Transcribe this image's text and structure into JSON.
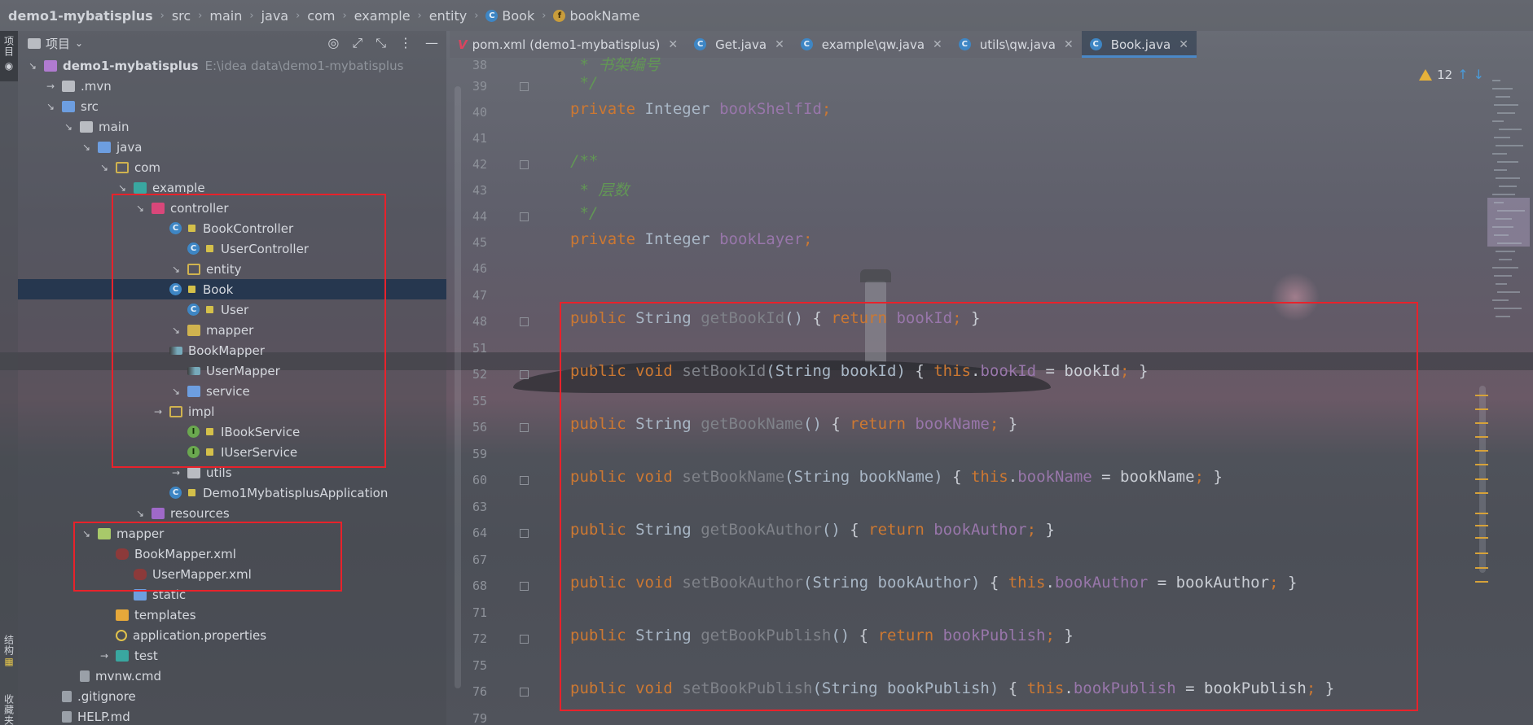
{
  "breadcrumb": [
    {
      "label": "demo1-mybatisplus",
      "bold": true
    },
    {
      "label": "src"
    },
    {
      "label": "main"
    },
    {
      "label": "java"
    },
    {
      "label": "com"
    },
    {
      "label": "example"
    },
    {
      "label": "entity"
    },
    {
      "label": "Book",
      "icon": "class-c-icon"
    },
    {
      "label": "bookName",
      "icon": "field-f-icon"
    }
  ],
  "left_strip": {
    "project_tab": "项目",
    "structure_tab": "结构",
    "favorites_tab": "收藏夹"
  },
  "project_panel": {
    "title": "项目",
    "tree": [
      {
        "label": "demo1-mybatisplus",
        "hint": "E:\\idea data\\demo1-mybatisplus",
        "bold": true,
        "icon": "module-icon",
        "arrow": "open"
      },
      {
        "label": ".mvn",
        "icon": "folder-icon",
        "arrow": "closed"
      },
      {
        "label": "src",
        "icon": "src-folder-icon",
        "arrow": "open"
      },
      {
        "label": "main",
        "icon": "folder-icon",
        "arrow": "open"
      },
      {
        "label": "java",
        "icon": "java-folder-icon",
        "arrow": "open"
      },
      {
        "label": "com",
        "icon": "package-icon",
        "arrow": "open"
      },
      {
        "label": "example",
        "icon": "package-teal-icon",
        "arrow": "open"
      },
      {
        "label": "controller",
        "icon": "controller-package-icon",
        "arrow": "open"
      },
      {
        "label": "BookController",
        "icon": "class-c-icon",
        "lock": true
      },
      {
        "label": "UserController",
        "icon": "class-c-icon",
        "lock": true
      },
      {
        "label": "entity",
        "icon": "package-icon",
        "arrow": "open"
      },
      {
        "label": "Book",
        "icon": "class-c-icon",
        "lock": true,
        "selected": true
      },
      {
        "label": "User",
        "icon": "class-c-icon",
        "lock": true
      },
      {
        "label": "mapper",
        "icon": "mapper-package-icon",
        "arrow": "open"
      },
      {
        "label": "BookMapper",
        "icon": "mybatis-mapper-icon"
      },
      {
        "label": "UserMapper",
        "icon": "mybatis-mapper-icon"
      },
      {
        "label": "service",
        "icon": "service-package-icon",
        "arrow": "open"
      },
      {
        "label": "impl",
        "icon": "package-icon",
        "arrow": "closed"
      },
      {
        "label": "IBookService",
        "icon": "interface-i-icon",
        "lock": true
      },
      {
        "label": "IUserService",
        "icon": "interface-i-icon",
        "lock": true
      },
      {
        "label": "utils",
        "icon": "folder-icon",
        "arrow": "closed"
      },
      {
        "label": "Demo1MybatisplusApplication",
        "icon": "spring-boot-class-icon",
        "lock": true
      },
      {
        "label": "resources",
        "icon": "resources-folder-icon",
        "arrow": "open"
      },
      {
        "label": "mapper",
        "icon": "folder-green-icon",
        "arrow": "open"
      },
      {
        "label": "BookMapper.xml",
        "icon": "xml-mapper-icon"
      },
      {
        "label": "UserMapper.xml",
        "icon": "xml-mapper-icon"
      },
      {
        "label": "static",
        "icon": "static-folder-icon"
      },
      {
        "label": "templates",
        "icon": "templates-folder-icon"
      },
      {
        "label": "application.properties",
        "icon": "spring-properties-icon"
      },
      {
        "label": "test",
        "icon": "test-folder-icon",
        "arrow": "closed"
      },
      {
        "label": "mvnw.cmd",
        "icon": "file-icon"
      },
      {
        "label": ".gitignore",
        "icon": "gitignore-icon"
      },
      {
        "label": "HELP.md",
        "icon": "markdown-icon"
      }
    ]
  },
  "tabs": [
    {
      "label": "pom.xml (demo1-mybatisplus)",
      "icon": "maven-icon"
    },
    {
      "label": "Get.java",
      "icon": "class-c-icon"
    },
    {
      "label": "example\\qw.java",
      "icon": "class-c-icon"
    },
    {
      "label": "utils\\qw.java",
      "icon": "class-c-icon"
    },
    {
      "label": "Book.java",
      "icon": "class-c-icon",
      "active": true
    }
  ],
  "inspection": {
    "count": "12"
  },
  "gutter_lines": [
    "38",
    "39",
    "40",
    "41",
    "42",
    "43",
    "44",
    "45",
    "46",
    "47",
    "48",
    "51",
    "52",
    "55",
    "56",
    "59",
    "60",
    "63",
    "64",
    "67",
    "68",
    "71",
    "72",
    "75",
    "76",
    "79"
  ],
  "code": {
    "l38": " * 书架编号",
    "l39": " */",
    "l40_kw": "private",
    "l40_type": "Integer",
    "l40_name": "bookShelfId",
    "l42": "/**",
    "l43": " * 层数",
    "l44": " */",
    "l45_kw": "private",
    "l45_type": "Integer",
    "l45_name": "bookLayer",
    "getters": [
      {
        "sig_kw": "public",
        "ret": "String",
        "name": "getBookId",
        "params": "()",
        "body_kw": "return",
        "body": "bookId",
        "setter": false
      },
      {
        "sig_kw": "public",
        "ret": "void",
        "name": "setBookId",
        "params": "String bookId",
        "body_kw": "this",
        "body": "bookId",
        "arg": "bookId",
        "setter": true
      },
      {
        "sig_kw": "public",
        "ret": "String",
        "name": "getBookName",
        "params": "()",
        "body_kw": "return",
        "body": "bookName",
        "setter": false
      },
      {
        "sig_kw": "public",
        "ret": "void",
        "name": "setBookName",
        "params": "String bookName",
        "body_kw": "this",
        "body": "bookName",
        "arg": "bookName",
        "setter": true
      },
      {
        "sig_kw": "public",
        "ret": "String",
        "name": "getBookAuthor",
        "params": "()",
        "body_kw": "return",
        "body": "bookAuthor",
        "setter": false
      },
      {
        "sig_kw": "public",
        "ret": "void",
        "name": "setBookAuthor",
        "params": "String bookAuthor",
        "body_kw": "this",
        "body": "bookAuthor",
        "arg": "bookAuthor",
        "setter": true
      },
      {
        "sig_kw": "public",
        "ret": "String",
        "name": "getBookPublish",
        "params": "()",
        "body_kw": "return",
        "body": "bookPublish",
        "setter": false
      },
      {
        "sig_kw": "public",
        "ret": "void",
        "name": "setBookPublish",
        "params": "String bookPublish",
        "body_kw": "this",
        "body": "bookPublish",
        "arg": "bookPublish",
        "setter": true
      }
    ]
  },
  "colors": {
    "highlight_box": "#e8222b",
    "keyword": "#cc7832",
    "field": "#9876aa",
    "comment": "#629755",
    "selection": "#26374f",
    "tab_underline": "#4a88c7",
    "warning": "#e5b13a"
  }
}
